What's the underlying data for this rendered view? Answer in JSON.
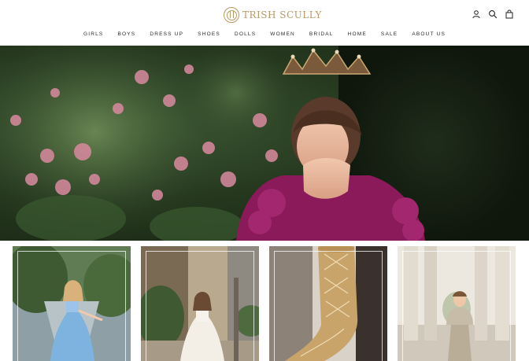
{
  "brand": {
    "name": "TRISH SCULLY",
    "accent": "#b79a62"
  },
  "header": {
    "icons": [
      "account-icon",
      "search-icon",
      "cart-icon"
    ]
  },
  "nav": {
    "items": [
      "GIRLS",
      "BOYS",
      "DRESS UP",
      "SHOES",
      "DOLLS",
      "WOMEN",
      "BRIDAL",
      "HOME",
      "SALE",
      "ABOUT US"
    ]
  },
  "hero": {
    "image": "girl-with-crown-in-rose-garden"
  },
  "tiles": [
    {
      "image": "girl-in-blue-gown"
    },
    {
      "image": "girl-in-white-dress"
    },
    {
      "image": "gold-lace-boots"
    },
    {
      "image": "boy-in-suit"
    }
  ]
}
